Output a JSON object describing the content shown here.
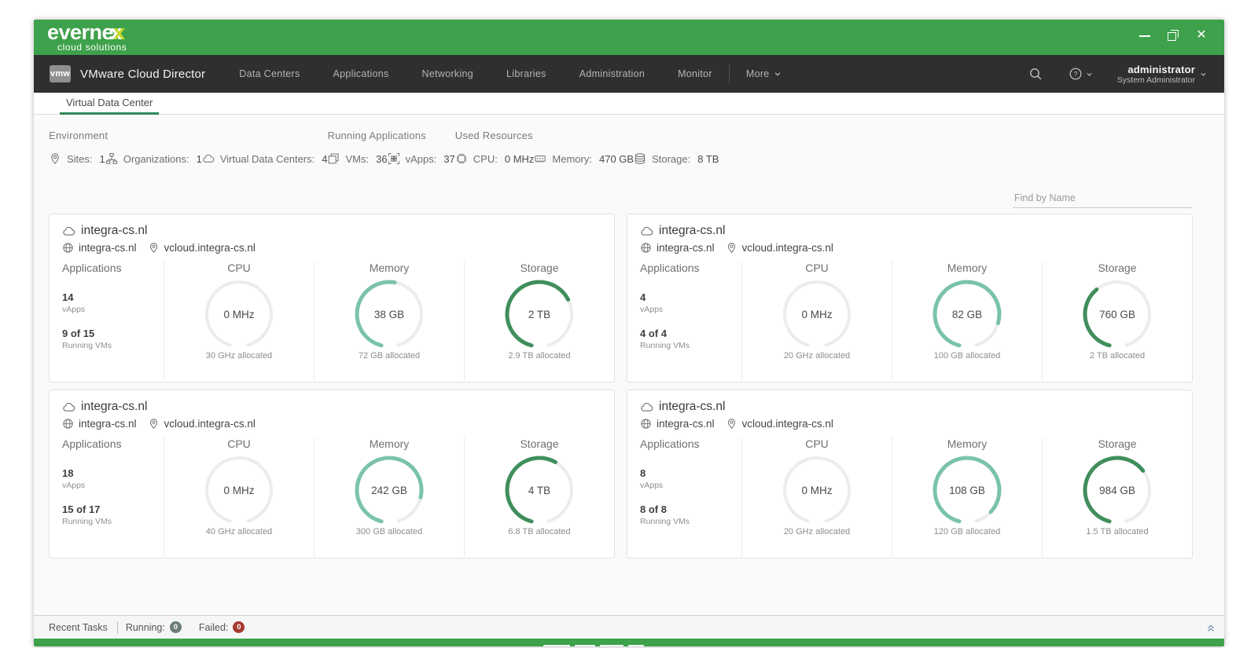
{
  "titlebar": {
    "brand_prefix": "everne",
    "brand_x": "x",
    "brand_tagline": "cloud solutions"
  },
  "nav": {
    "logo_text": "vmw",
    "product_title": "VMware Cloud Director",
    "tabs": [
      {
        "label": "Data Centers",
        "active": true
      },
      {
        "label": "Applications",
        "active": false
      },
      {
        "label": "Networking",
        "active": false
      },
      {
        "label": "Libraries",
        "active": false
      },
      {
        "label": "Administration",
        "active": false
      },
      {
        "label": "Monitor",
        "active": false
      }
    ],
    "more_label": "More",
    "user_name": "administrator",
    "user_role": "System Administrator"
  },
  "subnav": {
    "active_tab": "Virtual Data Center"
  },
  "summary": {
    "sections": [
      {
        "title": "Environment",
        "items": [
          {
            "icon": "pin",
            "label": "Sites:",
            "value": "1"
          },
          {
            "icon": "org",
            "label": "Organizations:",
            "value": "1"
          },
          {
            "icon": "cloud",
            "label": "Virtual Data Centers:",
            "value": "4"
          }
        ]
      },
      {
        "title": "Running Applications",
        "items": [
          {
            "icon": "vm",
            "label": "VMs:",
            "value": "36"
          },
          {
            "icon": "vapps",
            "label": "vApps:",
            "value": "37"
          }
        ]
      },
      {
        "title": "Used Resources",
        "items": [
          {
            "icon": "cpu",
            "label": "CPU:",
            "value": "0 MHz"
          },
          {
            "icon": "memory",
            "label": "Memory:",
            "value": "470 GB"
          },
          {
            "icon": "storage",
            "label": "Storage:",
            "value": "8 TB"
          }
        ]
      }
    ]
  },
  "search": {
    "placeholder": "Find by Name"
  },
  "colors": {
    "header_green": "#3ea14b",
    "memory_arc": "#7ac3ab",
    "storage_arc": "#3f8e5c",
    "gauge_track": "#ececec",
    "active_underline": "#2e8a5a"
  },
  "cards": [
    {
      "name": "integra-cs.nl",
      "org": "integra-cs.nl",
      "site": "vcloud.integra-cs.nl",
      "apps": {
        "title": "Applications",
        "vapps": "14",
        "vapps_label": "vApps",
        "running": "9 of 15",
        "running_label": "Running VMs"
      },
      "gauges": [
        {
          "title": "CPU",
          "center": "0 MHz",
          "allocated": "30 GHz allocated",
          "percent": 0,
          "color": "#7ac3ab"
        },
        {
          "title": "Memory",
          "center": "38 GB",
          "allocated": "72 GB allocated",
          "percent": 53,
          "color": "#7ac3ab"
        },
        {
          "title": "Storage",
          "center": "2 TB",
          "allocated": "2.9 TB allocated",
          "percent": 69,
          "color": "#3f8e5c"
        }
      ]
    },
    {
      "name": "integra-cs.nl",
      "org": "integra-cs.nl",
      "site": "vcloud.integra-cs.nl",
      "apps": {
        "title": "Applications",
        "vapps": "4",
        "vapps_label": "vApps",
        "running": "4 of 4",
        "running_label": "Running VMs"
      },
      "gauges": [
        {
          "title": "CPU",
          "center": "0 MHz",
          "allocated": "20 GHz allocated",
          "percent": 0,
          "color": "#7ac3ab"
        },
        {
          "title": "Memory",
          "center": "82 GB",
          "allocated": "100 GB allocated",
          "percent": 82,
          "color": "#7ac3ab"
        },
        {
          "title": "Storage",
          "center": "760 GB",
          "allocated": "2 TB allocated",
          "percent": 38,
          "color": "#3f8e5c"
        }
      ]
    },
    {
      "name": "integra-cs.nl",
      "org": "integra-cs.nl",
      "site": "vcloud.integra-cs.nl",
      "apps": {
        "title": "Applications",
        "vapps": "18",
        "vapps_label": "vApps",
        "running": "15 of 17",
        "running_label": "Running VMs"
      },
      "gauges": [
        {
          "title": "CPU",
          "center": "0 MHz",
          "allocated": "40 GHz allocated",
          "percent": 0,
          "color": "#7ac3ab"
        },
        {
          "title": "Memory",
          "center": "242 GB",
          "allocated": "300 GB allocated",
          "percent": 81,
          "color": "#7ac3ab"
        },
        {
          "title": "Storage",
          "center": "4 TB",
          "allocated": "6.8 TB allocated",
          "percent": 59,
          "color": "#3f8e5c"
        }
      ]
    },
    {
      "name": "integra-cs.nl",
      "org": "integra-cs.nl",
      "site": "vcloud.integra-cs.nl",
      "apps": {
        "title": "Applications",
        "vapps": "8",
        "vapps_label": "vApps",
        "running": "8 of 8",
        "running_label": "Running VMs"
      },
      "gauges": [
        {
          "title": "CPU",
          "center": "0 MHz",
          "allocated": "20 GHz allocated",
          "percent": 0,
          "color": "#7ac3ab"
        },
        {
          "title": "Memory",
          "center": "108 GB",
          "allocated": "120 GB allocated",
          "percent": 90,
          "color": "#7ac3ab"
        },
        {
          "title": "Storage",
          "center": "984 GB",
          "allocated": "1.5 TB allocated",
          "percent": 66,
          "color": "#3f8e5c"
        }
      ]
    }
  ],
  "tasks": {
    "title": "Recent Tasks",
    "running_label": "Running:",
    "running_count": "0",
    "failed_label": "Failed:",
    "failed_count": "0"
  }
}
